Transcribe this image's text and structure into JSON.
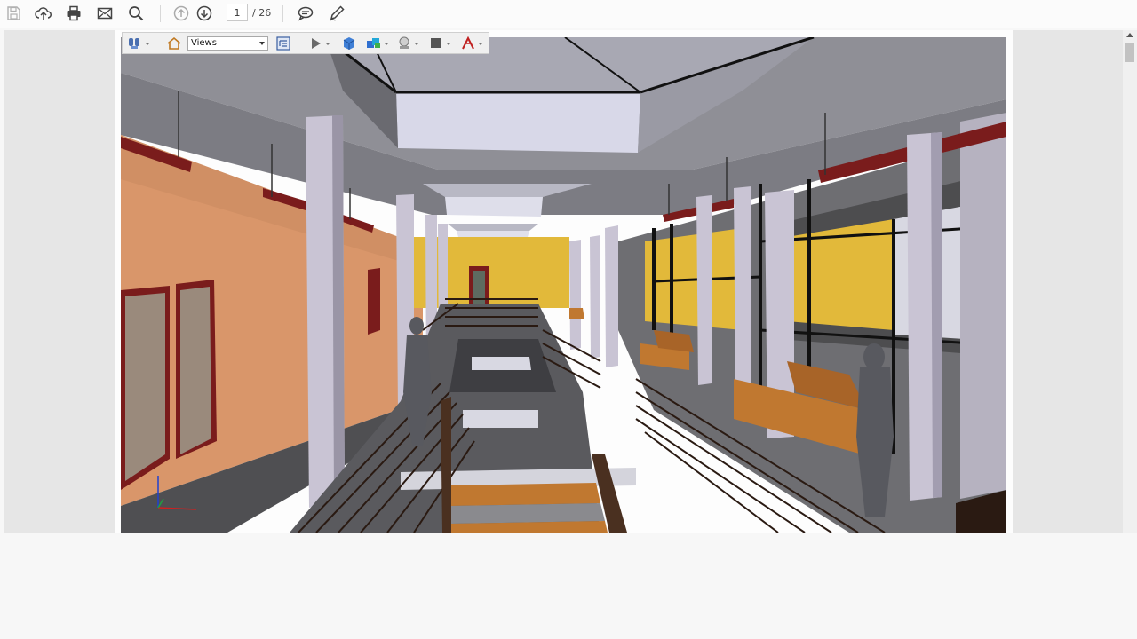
{
  "toolbar": {
    "page_current": "1",
    "page_total": "/ 26",
    "icons": [
      "save-icon",
      "upload-icon",
      "print-icon",
      "email-icon",
      "search-icon",
      "previous-page-icon",
      "next-page-icon",
      "comment-icon",
      "pen-icon"
    ]
  },
  "toolbar_3d": {
    "views_label": "Views",
    "icons": [
      "navigation-tools-icon",
      "home-view-icon",
      "model-tree-icon",
      "play-animation-icon",
      "render-mode-icon",
      "lighting-icon",
      "background-color-icon",
      "cross-section-icon"
    ]
  },
  "colors": {
    "toolbar_bg": "#fbfbfb",
    "doc_bg": "#e6e6e6",
    "wall_orange": "#d9966a",
    "wall_yellow": "#e2b93a",
    "pipe_red": "#7a1c1c",
    "column_lavender": "#c9c4d4",
    "sofa_orange": "#c07830"
  }
}
